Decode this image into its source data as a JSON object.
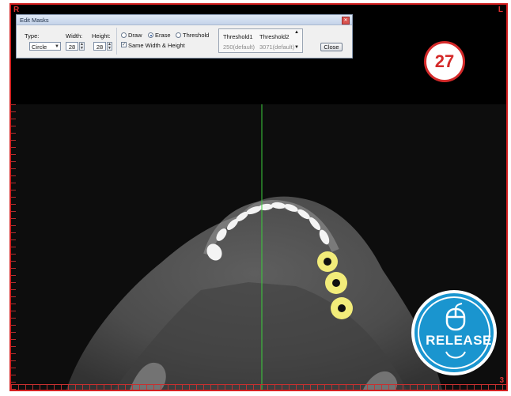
{
  "viewer": {
    "corner_top_left": "R",
    "corner_top_right": "L",
    "corner_bottom_right": "3",
    "crosshair_color": "#3cd03c",
    "mask_color": "#f2ec7a"
  },
  "dialog": {
    "title": "Edit Masks",
    "type_label": "Type:",
    "type_value": "Circle",
    "width_label": "Width:",
    "width_value": "28",
    "height_label": "Height:",
    "height_value": "28",
    "mode_options": [
      {
        "label": "Draw",
        "selected": false
      },
      {
        "label": "Erase",
        "selected": true
      },
      {
        "label": "Threshold",
        "selected": false
      }
    ],
    "same_size_label": "Same Width & Height",
    "same_size_checked": true,
    "threshold1_label": "Threshold1",
    "threshold2_label": "Threshold2",
    "threshold1_value": "250(default)",
    "threshold2_value": "3071(default)",
    "close_label": "Close"
  },
  "step_badge": {
    "number": "27",
    "color": "#d42a2a"
  },
  "release_badge": {
    "label": "RELEASE",
    "icon": "mouse-icon",
    "color": "#1a95cf"
  }
}
